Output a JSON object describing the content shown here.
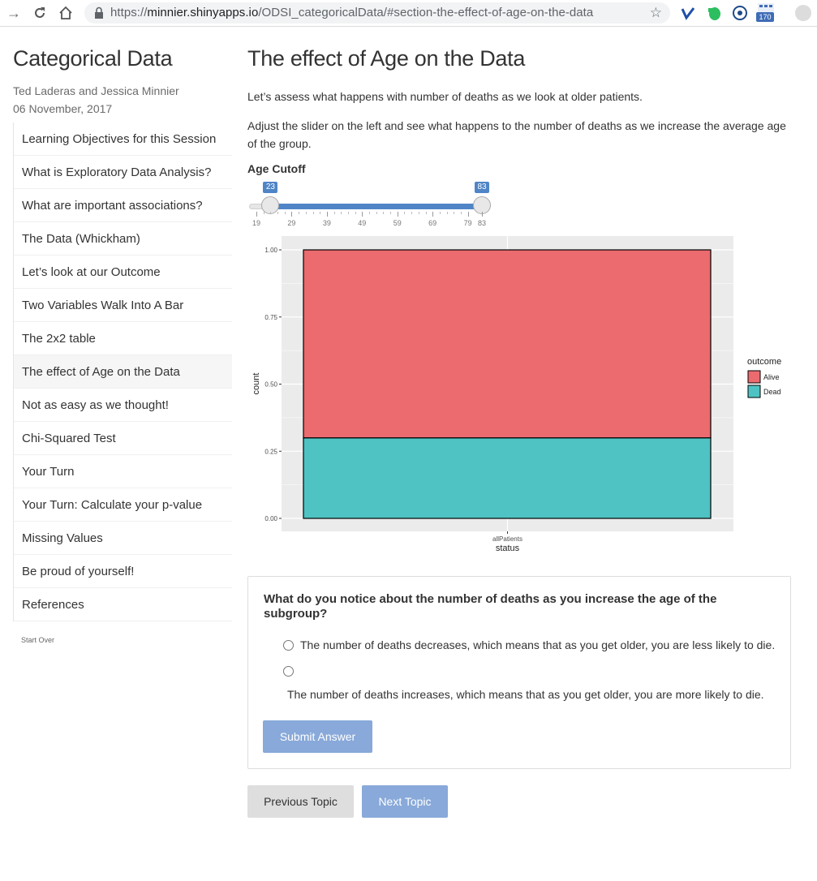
{
  "browser": {
    "url_prefix": "https://",
    "url_host": "minnier.shinyapps.io",
    "url_path": "/ODSI_categoricalData/#section-the-effect-of-age-on-the-data",
    "ext_badge": "170"
  },
  "sidebar": {
    "title": "Categorical Data",
    "authors": "Ted Laderas and Jessica Minnier",
    "date": "06 November, 2017",
    "items": [
      {
        "label": "Learning Objectives for this Session"
      },
      {
        "label": "What is Exploratory Data Analysis?"
      },
      {
        "label": "What are important associations?"
      },
      {
        "label": "The Data (Whickham)"
      },
      {
        "label": "Let’s look at our Outcome"
      },
      {
        "label": "Two Variables Walk Into A Bar"
      },
      {
        "label": "The 2x2 table"
      },
      {
        "label": "The effect of Age on the Data",
        "active": true
      },
      {
        "label": "Not as easy as we thought!"
      },
      {
        "label": "Chi-Squared Test"
      },
      {
        "label": "Your Turn"
      },
      {
        "label": "Your Turn: Calculate your p-value"
      },
      {
        "label": "Missing Values"
      },
      {
        "label": "Be proud of yourself!"
      },
      {
        "label": "References"
      }
    ],
    "start_over": "Start Over"
  },
  "main": {
    "title": "The effect of Age on the Data",
    "para1": "Let’s assess what happens with number of deaths as we look at older patients.",
    "para2": "Adjust the slider on the left and see what happens to the number of deaths as we increase the average age of the group.",
    "slider": {
      "label": "Age Cutoff",
      "min": 19,
      "max": 83,
      "low": 23,
      "high": 83,
      "low_label": "23",
      "high_label": "83",
      "ticks": [
        "19",
        "29",
        "39",
        "49",
        "59",
        "69",
        "79",
        "83"
      ]
    }
  },
  "chart_data": {
    "type": "bar",
    "stacked": true,
    "categories": [
      "allPatients"
    ],
    "series": [
      {
        "name": "Dead",
        "values": [
          0.3
        ],
        "color": "#4fc3c3"
      },
      {
        "name": "Alive",
        "values": [
          0.7
        ],
        "color": "#eb6b6f"
      }
    ],
    "xlabel": "status",
    "ylabel": "count",
    "yticks": [
      "0.00",
      "0.25",
      "0.50",
      "0.75",
      "1.00"
    ],
    "ylim": [
      0,
      1
    ],
    "legend_title": "outcome",
    "legend_items": [
      "Alive",
      "Dead"
    ],
    "legend_placement": "right",
    "grid": true,
    "panel_color": "#ebebeb"
  },
  "quiz": {
    "question": "What do you notice about the number of deaths as you increase the age of the subgroup?",
    "option1": "The number of deaths decreases, which means that as you get older, you are less likely to die.",
    "option2": "The number of deaths increases, which means that as you get older, you are more likely to die.",
    "submit_label": "Submit Answer"
  },
  "nav": {
    "previous_label": "Previous Topic",
    "next_label": "Next Topic"
  }
}
